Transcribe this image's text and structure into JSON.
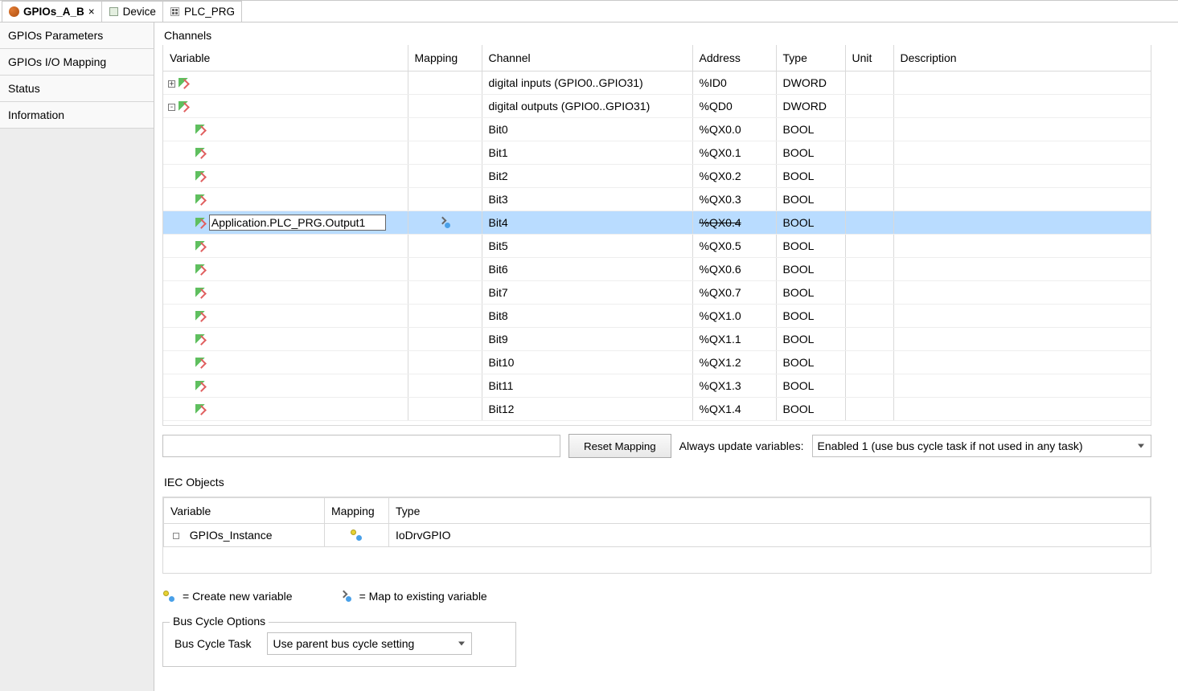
{
  "tabs": [
    {
      "label": "GPIOs_A_B",
      "active": true,
      "icon": "gpio"
    },
    {
      "label": "Device",
      "active": false,
      "icon": "device"
    },
    {
      "label": "PLC_PRG",
      "active": false,
      "icon": "plc"
    }
  ],
  "sidebar": [
    "GPIOs Parameters",
    "GPIOs I/O Mapping",
    "Status",
    "Information"
  ],
  "channels_title": "Channels",
  "headers": {
    "variable": "Variable",
    "mapping": "Mapping",
    "channel": "Channel",
    "address": "Address",
    "type": "Type",
    "unit": "Unit",
    "description": "Description"
  },
  "rows": [
    {
      "indent": 0,
      "toggle": "+",
      "variable": "",
      "mapping": "",
      "channel": "digital inputs (GPIO0..GPIO31)",
      "address": "%ID0",
      "type": "DWORD"
    },
    {
      "indent": 0,
      "toggle": "-",
      "variable": "",
      "mapping": "",
      "channel": "digital outputs (GPIO0..GPIO31)",
      "address": "%QD0",
      "type": "DWORD"
    },
    {
      "indent": 1,
      "variable": "",
      "mapping": "",
      "channel": "Bit0",
      "address": "%QX0.0",
      "type": "BOOL"
    },
    {
      "indent": 1,
      "variable": "",
      "mapping": "",
      "channel": "Bit1",
      "address": "%QX0.1",
      "type": "BOOL"
    },
    {
      "indent": 1,
      "variable": "",
      "mapping": "",
      "channel": "Bit2",
      "address": "%QX0.2",
      "type": "BOOL"
    },
    {
      "indent": 1,
      "variable": "",
      "mapping": "",
      "channel": "Bit3",
      "address": "%QX0.3",
      "type": "BOOL"
    },
    {
      "indent": 1,
      "variable": "Application.PLC_PRG.Output1",
      "mapping": "exist",
      "channel": "Bit4",
      "address": "%QX0.4",
      "type": "BOOL",
      "selected": true,
      "address_strike": true
    },
    {
      "indent": 1,
      "variable": "",
      "mapping": "",
      "channel": "Bit5",
      "address": "%QX0.5",
      "type": "BOOL"
    },
    {
      "indent": 1,
      "variable": "",
      "mapping": "",
      "channel": "Bit6",
      "address": "%QX0.6",
      "type": "BOOL"
    },
    {
      "indent": 1,
      "variable": "",
      "mapping": "",
      "channel": "Bit7",
      "address": "%QX0.7",
      "type": "BOOL"
    },
    {
      "indent": 1,
      "variable": "",
      "mapping": "",
      "channel": "Bit8",
      "address": "%QX1.0",
      "type": "BOOL"
    },
    {
      "indent": 1,
      "variable": "",
      "mapping": "",
      "channel": "Bit9",
      "address": "%QX1.1",
      "type": "BOOL"
    },
    {
      "indent": 1,
      "variable": "",
      "mapping": "",
      "channel": "Bit10",
      "address": "%QX1.2",
      "type": "BOOL"
    },
    {
      "indent": 1,
      "variable": "",
      "mapping": "",
      "channel": "Bit11",
      "address": "%QX1.3",
      "type": "BOOL"
    },
    {
      "indent": 1,
      "variable": "",
      "mapping": "",
      "channel": "Bit12",
      "address": "%QX1.4",
      "type": "BOOL"
    }
  ],
  "reset_button": "Reset Mapping",
  "update_label": "Always update variables:",
  "update_value": "Enabled 1 (use bus cycle task if not used in any task)",
  "iec_title": "IEC Objects",
  "iec": {
    "variable": "GPIOs_Instance",
    "mapping": "new",
    "type": "IoDrvGPIO"
  },
  "legend": {
    "new": "= Create new variable",
    "exist": "= Map to existing variable"
  },
  "bus_cycle": {
    "group": "Bus Cycle Options",
    "label": "Bus Cycle Task",
    "value": "Use parent bus cycle setting"
  }
}
